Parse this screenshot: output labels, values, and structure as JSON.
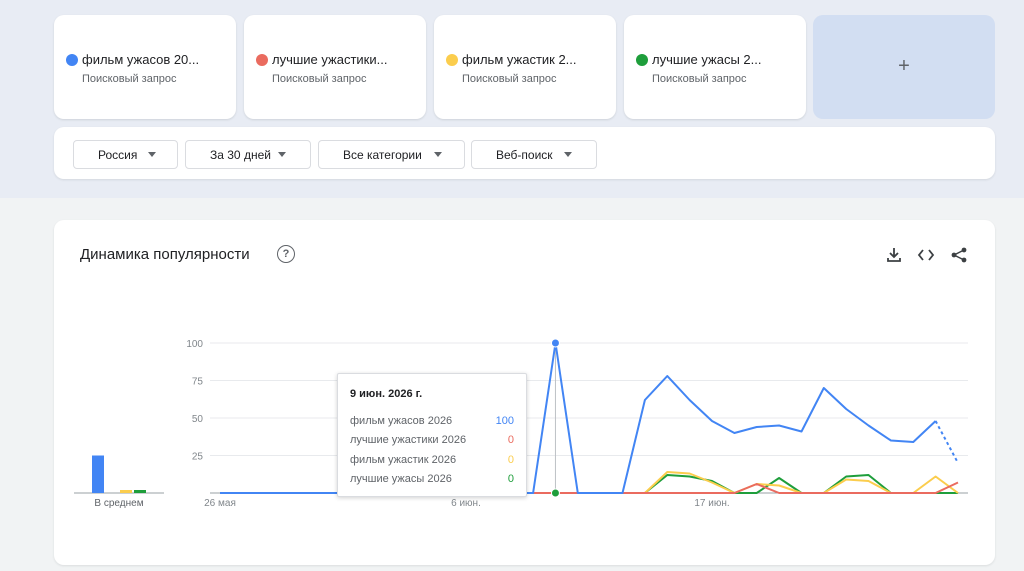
{
  "terms": [
    {
      "name": "фильм ужасов 20...",
      "type": "Поисковый запрос",
      "color": "#4285f4"
    },
    {
      "name": "лучшие ужастики...",
      "type": "Поисковый запрос",
      "color": "#ea6b5f"
    },
    {
      "name": "фильм ужастик 2...",
      "type": "Поисковый запрос",
      "color": "#fbcd4d"
    },
    {
      "name": "лучшие ужасы 2...",
      "type": "Поисковый запрос",
      "color": "#1e9e3b"
    }
  ],
  "add_label": "+",
  "filters": [
    {
      "label": "Россия"
    },
    {
      "label": "За 30 дней"
    },
    {
      "label": "Все категории"
    },
    {
      "label": "Веб-поиск"
    }
  ],
  "panel": {
    "title": "Динамика популярности",
    "help_glyph": "?",
    "tools": [
      "download-icon",
      "embed-code-icon",
      "share-icon"
    ]
  },
  "chart_data": {
    "type": "line",
    "ylim": [
      0,
      100
    ],
    "yticks": [
      "100",
      "75",
      "50",
      "25"
    ],
    "xticks": [
      "26 мая",
      "6 июн.",
      "17 июн."
    ],
    "x_count": 31,
    "grid": true,
    "series": [
      {
        "name": "фильм ужасов 2026",
        "color": "#4285f4",
        "values": [
          0,
          0,
          0,
          0,
          0,
          0,
          0,
          0,
          0,
          0,
          0,
          0,
          0,
          0,
          0,
          100,
          0,
          0,
          0,
          62,
          78,
          62,
          48,
          40,
          44,
          45,
          41,
          70,
          56,
          45,
          35,
          34,
          48,
          20
        ],
        "dotted_from": 32
      },
      {
        "name": "лучшие ужастики 2026",
        "color": "#ea6b5f",
        "values": [
          0,
          0,
          0,
          0,
          0,
          0,
          0,
          0,
          0,
          0,
          0,
          0,
          0,
          0,
          0,
          0,
          0,
          0,
          0,
          0,
          0,
          0,
          0,
          0,
          6,
          0,
          0,
          0,
          0,
          0,
          0,
          0,
          0,
          7,
          0,
          0
        ]
      },
      {
        "name": "фильм ужастик 2026",
        "color": "#fbcd4d",
        "values": [
          0,
          0,
          0,
          0,
          0,
          0,
          0,
          0,
          0,
          0,
          0,
          0,
          0,
          0,
          0,
          0,
          0,
          0,
          0,
          0,
          14,
          13,
          7,
          0,
          6,
          5,
          0,
          0,
          9,
          8,
          0,
          0,
          11,
          0,
          0
        ]
      },
      {
        "name": "лучшие ужасы 2026",
        "color": "#1e9e3b",
        "values": [
          0,
          0,
          0,
          0,
          0,
          0,
          0,
          0,
          0,
          0,
          0,
          0,
          0,
          0,
          0,
          0,
          0,
          0,
          0,
          0,
          12,
          11,
          8,
          0,
          0,
          10,
          0,
          0,
          11,
          12,
          0,
          0,
          0,
          0,
          0
        ]
      }
    ],
    "average": {
      "label": "В среднем",
      "values": [
        25,
        0,
        2,
        2
      ]
    },
    "tooltip": {
      "date": "9 июн. 2026 г.",
      "rows": [
        {
          "name": "фильм ужасов 2026",
          "value": "100",
          "color": "#4285f4"
        },
        {
          "name": "лучшие ужастики 2026",
          "value": "0",
          "color": "#ea6b5f"
        },
        {
          "name": "фильм ужастик 2026",
          "value": "0",
          "color": "#fbcd4d"
        },
        {
          "name": "лучшие ужасы 2026",
          "value": "0",
          "color": "#1e9e3b"
        }
      ]
    }
  }
}
